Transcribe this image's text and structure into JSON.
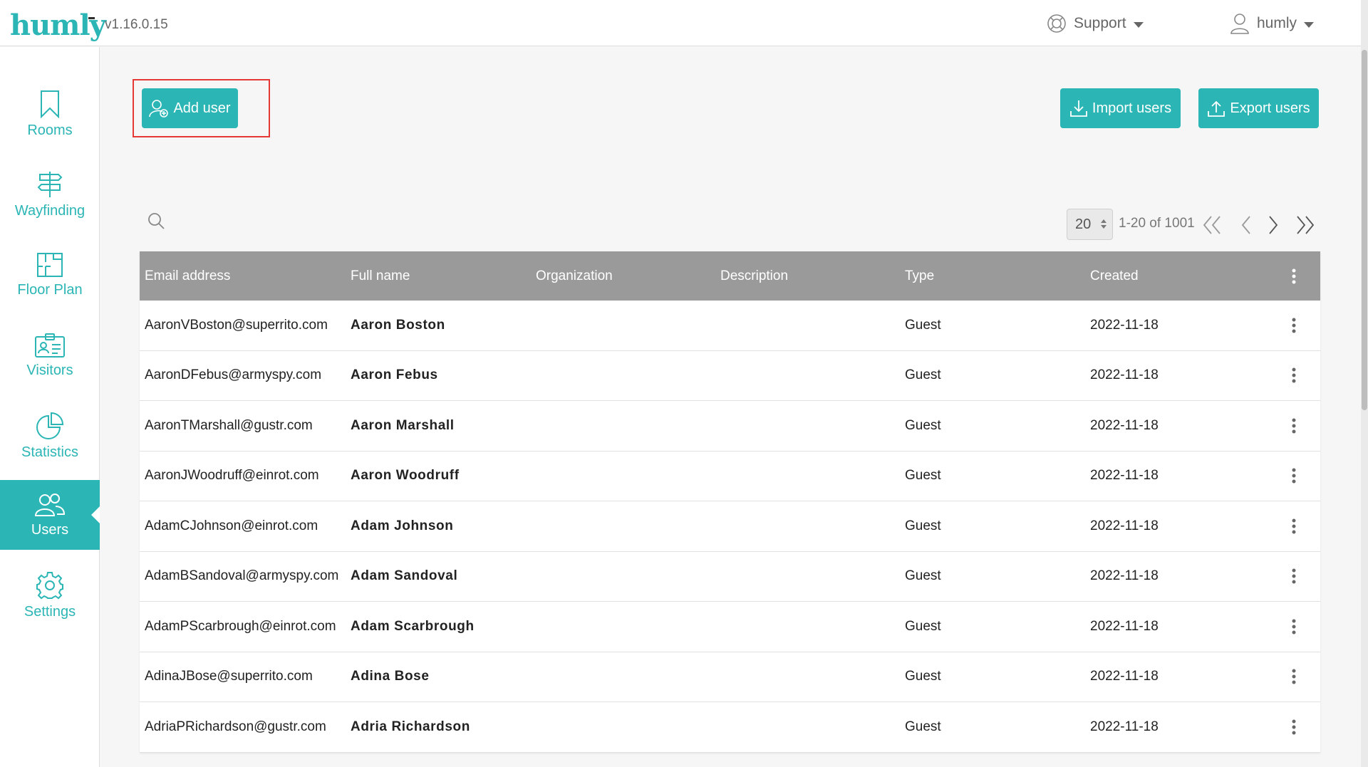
{
  "app": {
    "logo": "humly",
    "version": "v1.16.0.15",
    "accent_color": "#2bb5b5",
    "highlight_color": "#e53935"
  },
  "header": {
    "support_label": "Support",
    "support_icon": "lifebuoy-icon",
    "user_label": "humly",
    "user_icon": "user-icon"
  },
  "sidebar": {
    "items": [
      {
        "label": "Rooms",
        "icon": "bookmark-icon",
        "active": false
      },
      {
        "label": "Wayfinding",
        "icon": "signpost-icon",
        "active": false
      },
      {
        "label": "Floor Plan",
        "icon": "floor-plan-icon",
        "active": false
      },
      {
        "label": "Visitors",
        "icon": "id-card-icon",
        "active": false
      },
      {
        "label": "Statistics",
        "icon": "pie-chart-icon",
        "active": false
      },
      {
        "label": "Users",
        "icon": "users-icon",
        "active": true
      },
      {
        "label": "Settings",
        "icon": "gear-icon",
        "active": false
      }
    ]
  },
  "actions": {
    "add_user": "Add user",
    "import_users": "Import users",
    "export_users": "Export users"
  },
  "pagination": {
    "page_size": "20",
    "range": "1-20 of 1001"
  },
  "table": {
    "columns": [
      "Email address",
      "Full name",
      "Organization",
      "Description",
      "Type",
      "Created"
    ],
    "rows": [
      {
        "email": "AaronVBoston@superrito.com",
        "name": "Aaron Boston",
        "org": "",
        "desc": "",
        "type": "Guest",
        "created": "2022-11-18"
      },
      {
        "email": "AaronDFebus@armyspy.com",
        "name": "Aaron Febus",
        "org": "",
        "desc": "",
        "type": "Guest",
        "created": "2022-11-18"
      },
      {
        "email": "AaronTMarshall@gustr.com",
        "name": "Aaron Marshall",
        "org": "",
        "desc": "",
        "type": "Guest",
        "created": "2022-11-18"
      },
      {
        "email": "AaronJWoodruff@einrot.com",
        "name": "Aaron Woodruff",
        "org": "",
        "desc": "",
        "type": "Guest",
        "created": "2022-11-18"
      },
      {
        "email": "AdamCJohnson@einrot.com",
        "name": "Adam Johnson",
        "org": "",
        "desc": "",
        "type": "Guest",
        "created": "2022-11-18"
      },
      {
        "email": "AdamBSandoval@armyspy.com",
        "name": "Adam Sandoval",
        "org": "",
        "desc": "",
        "type": "Guest",
        "created": "2022-11-18"
      },
      {
        "email": "AdamPScarbrough@einrot.com",
        "name": "Adam Scarbrough",
        "org": "",
        "desc": "",
        "type": "Guest",
        "created": "2022-11-18"
      },
      {
        "email": "AdinaJBose@superrito.com",
        "name": "Adina Bose",
        "org": "",
        "desc": "",
        "type": "Guest",
        "created": "2022-11-18"
      },
      {
        "email": "AdriaPRichardson@gustr.com",
        "name": "Adria Richardson",
        "org": "",
        "desc": "",
        "type": "Guest",
        "created": "2022-11-18"
      }
    ]
  }
}
